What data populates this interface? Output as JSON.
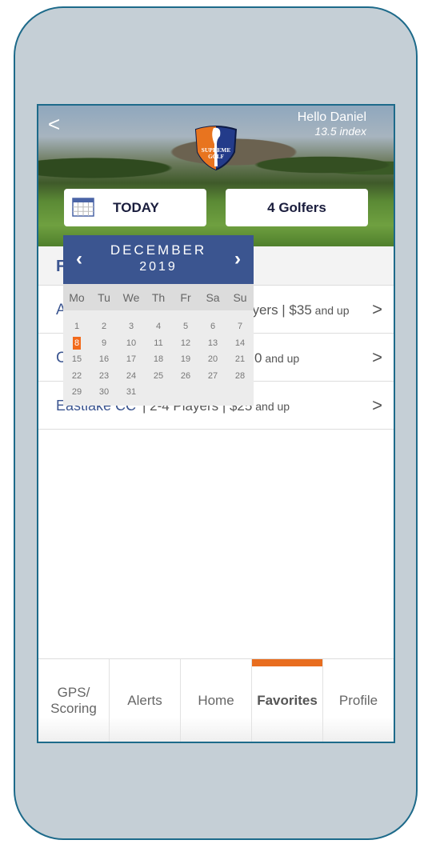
{
  "header": {
    "back": "<",
    "greeting": "Hello Daniel",
    "index": "13.5 index",
    "logo_text": "SUPREME GOLF"
  },
  "date_button": {
    "label": "TODAY",
    "icon": "calendar-icon"
  },
  "golfers_button": {
    "label": "4 Golfers"
  },
  "section": {
    "title": "F"
  },
  "rows": [
    {
      "name": "A",
      "detail": "ayers | $35",
      "suffix": " and up",
      "chev": ">"
    },
    {
      "name": "C",
      "detail": "0",
      "suffix": " and up",
      "chev": ">"
    },
    {
      "name": "Eastlake CC",
      "detail": " | 2-4 Players | $25",
      "suffix": " and up",
      "chev": ">"
    }
  ],
  "calendar": {
    "month": "DECEMBER",
    "year": "2019",
    "prev": "‹",
    "next": "›",
    "weekdays": [
      "Mo",
      "Tu",
      "We",
      "Th",
      "Fr",
      "Sa",
      "Su"
    ],
    "days": [
      "1",
      "2",
      "3",
      "4",
      "5",
      "6",
      "7",
      "8",
      "9",
      "10",
      "11",
      "12",
      "13",
      "14",
      "15",
      "16",
      "17",
      "18",
      "19",
      "20",
      "21",
      "22",
      "23",
      "24",
      "25",
      "26",
      "27",
      "28",
      "29",
      "30",
      "31"
    ],
    "selected": "8",
    "selected_color": "#f26a1b",
    "header_color": "#3b5590"
  },
  "tabs": [
    {
      "label": "GPS/\nScoring"
    },
    {
      "label": "Alerts"
    },
    {
      "label": "Home"
    },
    {
      "label": "Favorites",
      "active": true
    },
    {
      "label": "Profile"
    }
  ],
  "accent": "#e86d1f"
}
